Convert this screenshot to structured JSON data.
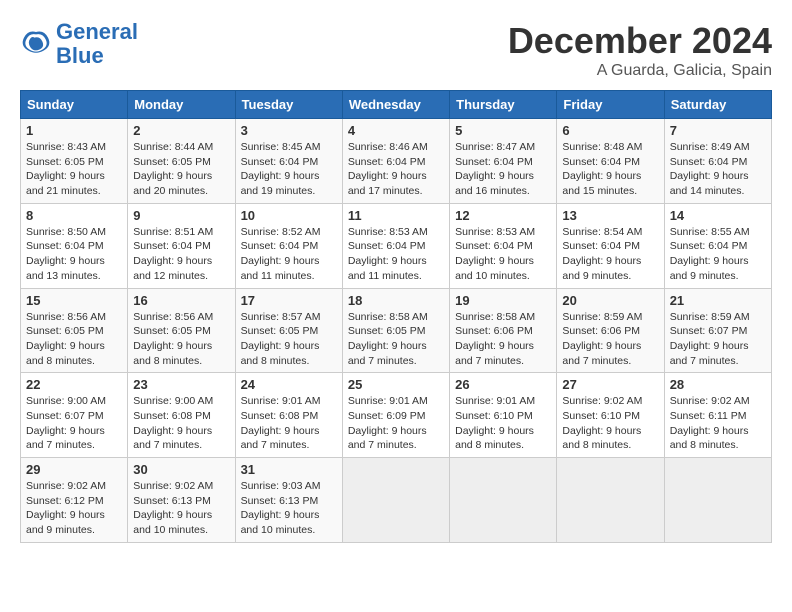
{
  "logo": {
    "line1": "General",
    "line2": "Blue"
  },
  "title": "December 2024",
  "location": "A Guarda, Galicia, Spain",
  "headers": [
    "Sunday",
    "Monday",
    "Tuesday",
    "Wednesday",
    "Thursday",
    "Friday",
    "Saturday"
  ],
  "weeks": [
    [
      {
        "day": "1",
        "sunrise": "8:43 AM",
        "sunset": "6:05 PM",
        "daylight": "9 hours and 21 minutes."
      },
      {
        "day": "2",
        "sunrise": "8:44 AM",
        "sunset": "6:05 PM",
        "daylight": "9 hours and 20 minutes."
      },
      {
        "day": "3",
        "sunrise": "8:45 AM",
        "sunset": "6:04 PM",
        "daylight": "9 hours and 19 minutes."
      },
      {
        "day": "4",
        "sunrise": "8:46 AM",
        "sunset": "6:04 PM",
        "daylight": "9 hours and 17 minutes."
      },
      {
        "day": "5",
        "sunrise": "8:47 AM",
        "sunset": "6:04 PM",
        "daylight": "9 hours and 16 minutes."
      },
      {
        "day": "6",
        "sunrise": "8:48 AM",
        "sunset": "6:04 PM",
        "daylight": "9 hours and 15 minutes."
      },
      {
        "day": "7",
        "sunrise": "8:49 AM",
        "sunset": "6:04 PM",
        "daylight": "9 hours and 14 minutes."
      }
    ],
    [
      {
        "day": "8",
        "sunrise": "8:50 AM",
        "sunset": "6:04 PM",
        "daylight": "9 hours and 13 minutes."
      },
      {
        "day": "9",
        "sunrise": "8:51 AM",
        "sunset": "6:04 PM",
        "daylight": "9 hours and 12 minutes."
      },
      {
        "day": "10",
        "sunrise": "8:52 AM",
        "sunset": "6:04 PM",
        "daylight": "9 hours and 11 minutes."
      },
      {
        "day": "11",
        "sunrise": "8:53 AM",
        "sunset": "6:04 PM",
        "daylight": "9 hours and 11 minutes."
      },
      {
        "day": "12",
        "sunrise": "8:53 AM",
        "sunset": "6:04 PM",
        "daylight": "9 hours and 10 minutes."
      },
      {
        "day": "13",
        "sunrise": "8:54 AM",
        "sunset": "6:04 PM",
        "daylight": "9 hours and 9 minutes."
      },
      {
        "day": "14",
        "sunrise": "8:55 AM",
        "sunset": "6:04 PM",
        "daylight": "9 hours and 9 minutes."
      }
    ],
    [
      {
        "day": "15",
        "sunrise": "8:56 AM",
        "sunset": "6:05 PM",
        "daylight": "9 hours and 8 minutes."
      },
      {
        "day": "16",
        "sunrise": "8:56 AM",
        "sunset": "6:05 PM",
        "daylight": "9 hours and 8 minutes."
      },
      {
        "day": "17",
        "sunrise": "8:57 AM",
        "sunset": "6:05 PM",
        "daylight": "9 hours and 8 minutes."
      },
      {
        "day": "18",
        "sunrise": "8:58 AM",
        "sunset": "6:05 PM",
        "daylight": "9 hours and 7 minutes."
      },
      {
        "day": "19",
        "sunrise": "8:58 AM",
        "sunset": "6:06 PM",
        "daylight": "9 hours and 7 minutes."
      },
      {
        "day": "20",
        "sunrise": "8:59 AM",
        "sunset": "6:06 PM",
        "daylight": "9 hours and 7 minutes."
      },
      {
        "day": "21",
        "sunrise": "8:59 AM",
        "sunset": "6:07 PM",
        "daylight": "9 hours and 7 minutes."
      }
    ],
    [
      {
        "day": "22",
        "sunrise": "9:00 AM",
        "sunset": "6:07 PM",
        "daylight": "9 hours and 7 minutes."
      },
      {
        "day": "23",
        "sunrise": "9:00 AM",
        "sunset": "6:08 PM",
        "daylight": "9 hours and 7 minutes."
      },
      {
        "day": "24",
        "sunrise": "9:01 AM",
        "sunset": "6:08 PM",
        "daylight": "9 hours and 7 minutes."
      },
      {
        "day": "25",
        "sunrise": "9:01 AM",
        "sunset": "6:09 PM",
        "daylight": "9 hours and 7 minutes."
      },
      {
        "day": "26",
        "sunrise": "9:01 AM",
        "sunset": "6:10 PM",
        "daylight": "9 hours and 8 minutes."
      },
      {
        "day": "27",
        "sunrise": "9:02 AM",
        "sunset": "6:10 PM",
        "daylight": "9 hours and 8 minutes."
      },
      {
        "day": "28",
        "sunrise": "9:02 AM",
        "sunset": "6:11 PM",
        "daylight": "9 hours and 8 minutes."
      }
    ],
    [
      {
        "day": "29",
        "sunrise": "9:02 AM",
        "sunset": "6:12 PM",
        "daylight": "9 hours and 9 minutes."
      },
      {
        "day": "30",
        "sunrise": "9:02 AM",
        "sunset": "6:13 PM",
        "daylight": "9 hours and 10 minutes."
      },
      {
        "day": "31",
        "sunrise": "9:03 AM",
        "sunset": "6:13 PM",
        "daylight": "9 hours and 10 minutes."
      },
      null,
      null,
      null,
      null
    ]
  ],
  "labels": {
    "sunrise": "Sunrise:",
    "sunset": "Sunset:",
    "daylight": "Daylight:"
  }
}
